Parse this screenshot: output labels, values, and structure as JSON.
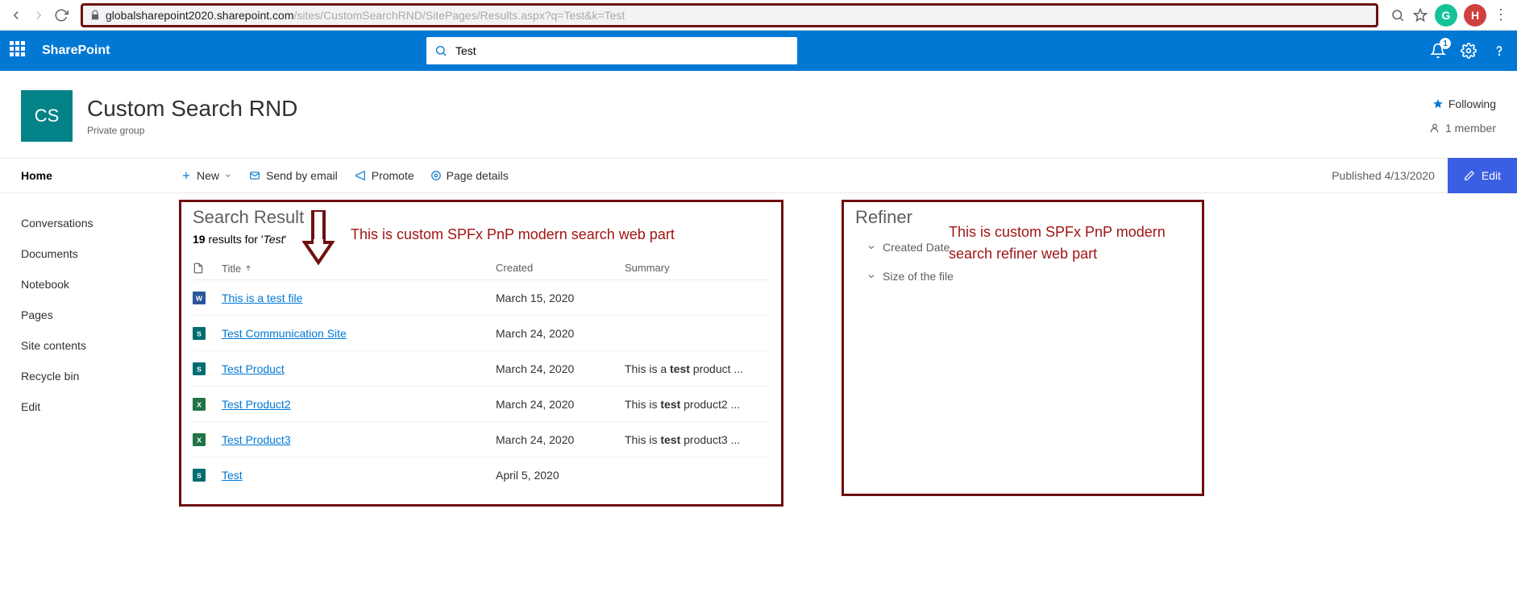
{
  "browser": {
    "url_host": "globalsharepoint2020.sharepoint.com",
    "url_path": "/sites/CustomSearchRND/SitePages/Results.aspx?q=Test&k=Test",
    "ext_grammarly": "G",
    "ext_profile": "H"
  },
  "suite": {
    "brand": "SharePoint",
    "search_value": "Test",
    "notif_count": "1"
  },
  "site": {
    "logo_text": "CS",
    "title": "Custom Search RND",
    "subtitle": "Private group",
    "following": "Following",
    "members": "1 member"
  },
  "nav": {
    "current": "Home",
    "items": [
      "Conversations",
      "Documents",
      "Notebook",
      "Pages",
      "Site contents",
      "Recycle bin",
      "Edit"
    ]
  },
  "cmd": {
    "new": "New",
    "send": "Send by email",
    "promote": "Promote",
    "details": "Page details",
    "published": "Published 4/13/2020",
    "edit": "Edit"
  },
  "results": {
    "title": "Search Result",
    "count_num": "19",
    "count_mid": " results for '",
    "count_term": "Test",
    "count_end": "'",
    "col_title": "Title",
    "col_created": "Created",
    "col_summary": "Summary",
    "rows": [
      {
        "icon": "word",
        "title": "This is a test file",
        "created": "March 15, 2020",
        "summary": ""
      },
      {
        "icon": "sp",
        "title": "Test Communication Site",
        "created": "March 24, 2020",
        "summary": ""
      },
      {
        "icon": "sp",
        "title": "Test Product",
        "created": "March 24, 2020",
        "summary": "This is a <b>test</b> product ..."
      },
      {
        "icon": "excel",
        "title": "Test Product2",
        "created": "March 24, 2020",
        "summary": "This is <b>test</b> product2 ..."
      },
      {
        "icon": "excel",
        "title": "Test Product3",
        "created": "March 24, 2020",
        "summary": "This is <b>test</b> product3 ..."
      },
      {
        "icon": "sp",
        "title": "Test",
        "created": "April 5, 2020",
        "summary": ""
      }
    ]
  },
  "refiner": {
    "title": "Refiner",
    "items": [
      "Created Date",
      "Size of the file"
    ]
  },
  "annotations": {
    "results": "This is custom SPFx PnP modern search web part",
    "refiner": "This is custom SPFx PnP modern search refiner web part"
  }
}
